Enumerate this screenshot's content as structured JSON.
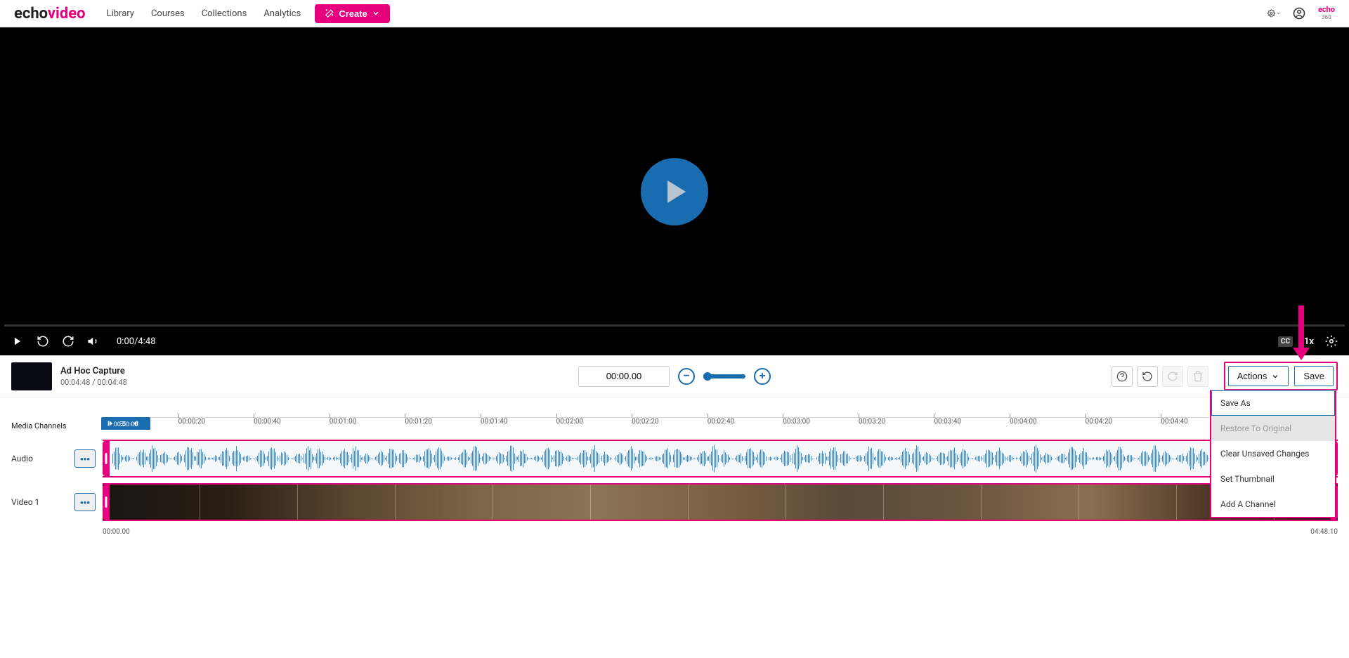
{
  "header": {
    "logo_prefix": "echo",
    "logo_suffix": "video",
    "nav": [
      "Library",
      "Courses",
      "Collections",
      "Analytics"
    ],
    "create_label": "Create",
    "echo360": "echo"
  },
  "player": {
    "time_display": "0:00/4:48",
    "speed": "1x",
    "cc": "CC"
  },
  "video_info": {
    "title": "Ad Hoc Capture",
    "duration": "00:04:48 / 00:04:48"
  },
  "editor": {
    "timecode": "00:00.00",
    "actions_label": "Actions",
    "save_label": "Save",
    "dropdown": [
      {
        "label": "Save As",
        "state": "active"
      },
      {
        "label": "Restore To Original",
        "state": "disabled"
      },
      {
        "label": "Clear Unsaved Changes",
        "state": "normal"
      },
      {
        "label": "Set Thumbnail",
        "state": "normal"
      },
      {
        "label": "Add A Channel",
        "state": "normal"
      }
    ]
  },
  "timeline": {
    "media_channels_label": "Media Channels",
    "playhead_time": "00:00:00",
    "ruler_ticks": [
      "00:00:20",
      "00:00:40",
      "00:01:00",
      "00:01:20",
      "00:01:40",
      "00:02:00",
      "00:02:20",
      "00:02:40",
      "00:03:00",
      "00:03:20",
      "00:03:40",
      "00:04:00",
      "00:04:20",
      "00:04:40"
    ],
    "track_audio": "Audio",
    "track_video": "Video 1",
    "start_time": "00:00.00",
    "end_time": "04:48.10"
  }
}
